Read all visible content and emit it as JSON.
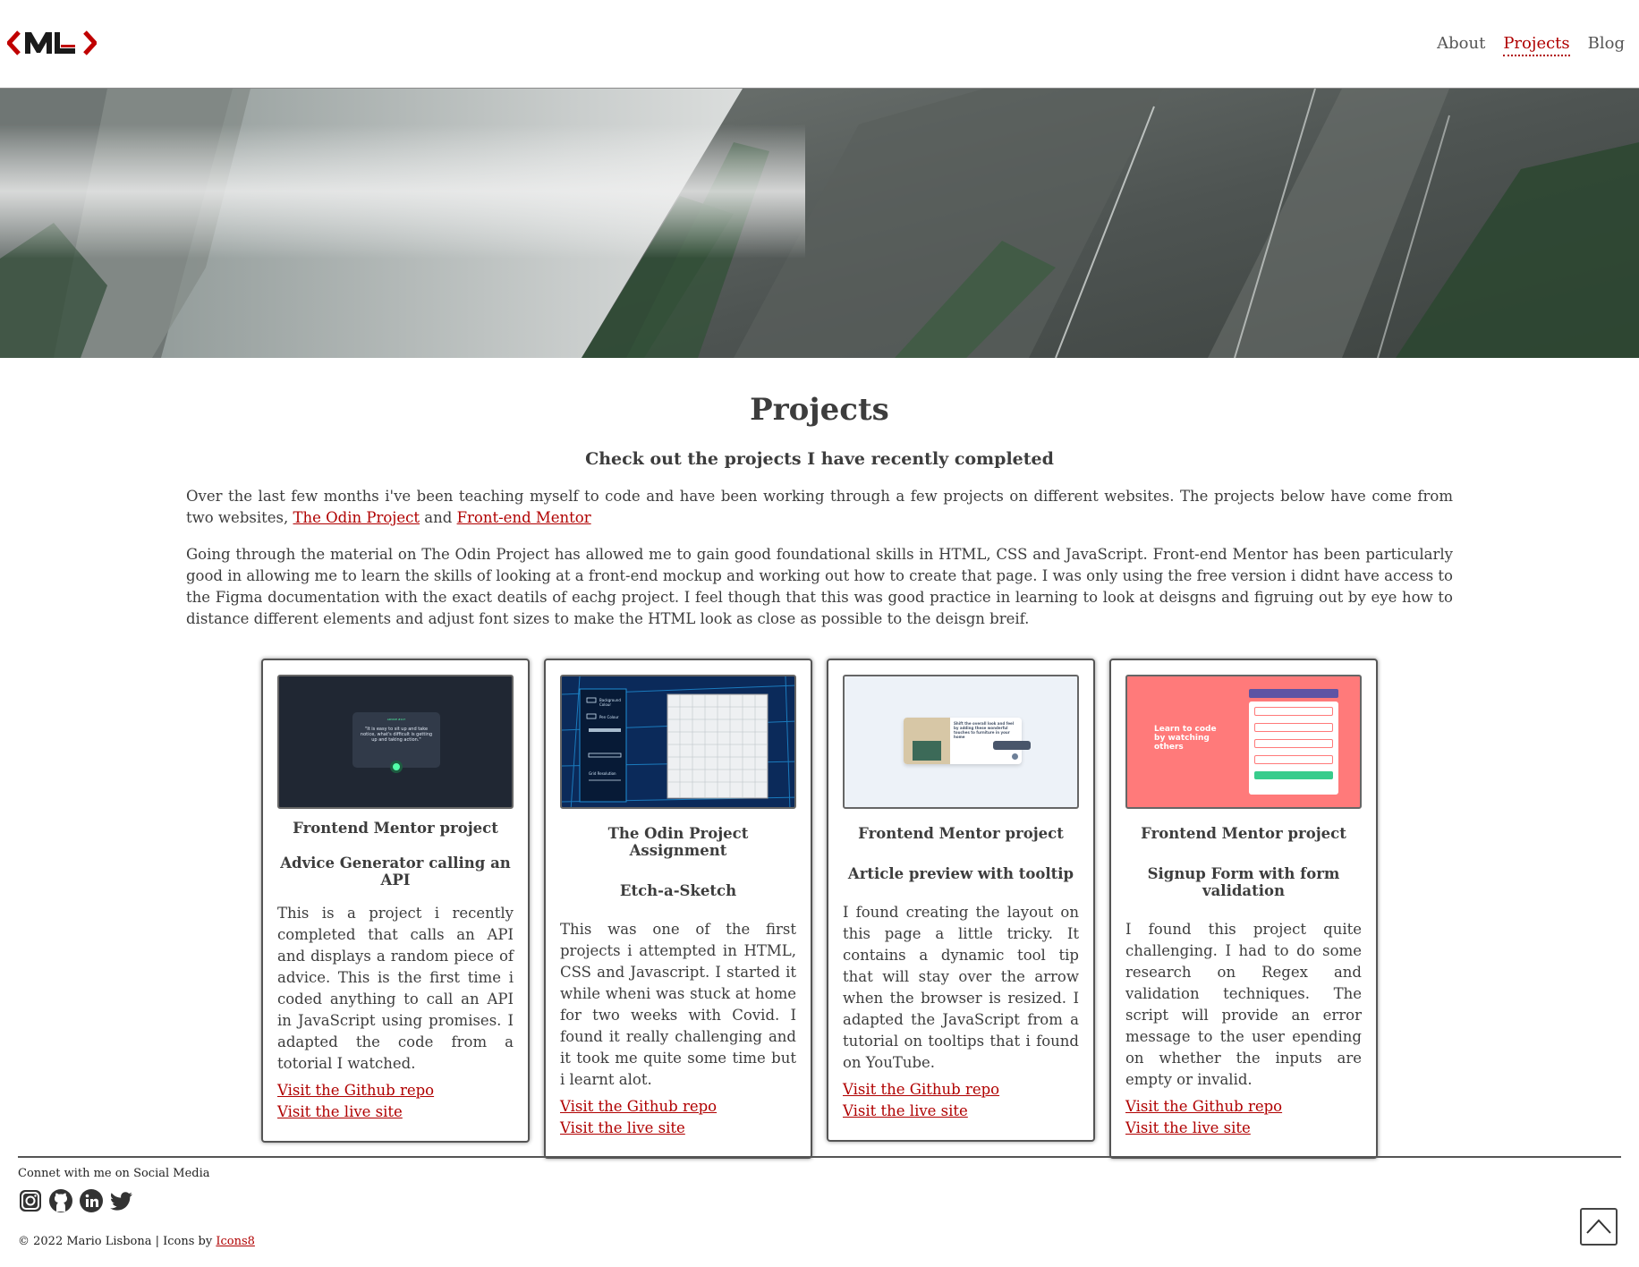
{
  "header": {
    "logo_text": "ML",
    "nav": [
      {
        "label": "About"
      },
      {
        "label": "Projects",
        "active": true
      },
      {
        "label": "Blog"
      }
    ]
  },
  "hero": {
    "icon": "mountain-landscape-photo"
  },
  "main": {
    "title": "Projects",
    "subtitle": "Check out the projects I have recently completed",
    "intro_p1_text": "Over the last few months i've been teaching myself to code and have been working through a few projects on different websites. The projects below have come from two websites, ",
    "intro_p1_link1": "The Odin Project",
    "intro_p1_and": " and ",
    "intro_p1_link2": "Front-end Mentor",
    "intro_p2": "Going through the material on The Odin Project has allowed me to gain good foundational skills in HTML, CSS and JavaScript. Front-end Mentor has been particularly good in allowing me to learn the skills of looking at a front-end mockup and working out how to create that page. I was only using the free version i didnt have access to the Figma documentation with the exact deatils of eachg project. I feel though that this was good practice in learning to look at deisgns and figruing out by eye how to distance different elements and adjust font sizes to make the HTML look as close as possible to the deisgn breif."
  },
  "projects": [
    {
      "source": "Frontend Mentor project",
      "name": "Advice Generator calling an API",
      "description": "This is a project i recently completed that calls an API and displays a random piece of advice. This is the first time i coded anything to call an API in JavaScript using promises. I adapted the code from a totorial I watched.",
      "repo_label": "Visit the Github repo",
      "live_label": "Visit the live site",
      "thumb": {
        "quote": "\"It is easy to sit up and take notice, what's difficult is getting up and taking action.\"",
        "small_label": "ADVICE #117"
      }
    },
    {
      "source": "The Odin Project Assignment",
      "name": "Etch-a-Sketch",
      "description": "This was one of the first projects i attempted in HTML, CSS and Javascript. I started it while wheni was stuck at home for two weeks with Covid. I found it really challenging and it took me quite some time but i learnt alot.",
      "repo_label": "Visit the Github repo",
      "live_label": "Visit the live site",
      "thumb": {
        "opt1": "Background Colour",
        "opt2": "Pen Colour",
        "opt3": "Grid Resolution"
      }
    },
    {
      "source": "Frontend Mentor project",
      "name": "Article preview with tooltip",
      "description": "I found creating the layout on this page a little tricky. It contains a dynamic tool tip that will stay over the arrow when the browser is resized. I adapted the JavaScript from a tutorial on tooltips that i found on YouTube.",
      "repo_label": "Visit the Github repo",
      "live_label": "Visit the live site",
      "thumb": {
        "headline": "Shift the overall look and feel by adding these wonderful touches to furniture in your home"
      }
    },
    {
      "source": "Frontend Mentor project",
      "name": "Signup Form with form validation",
      "description": "I found this project quite challenging. I had to do some research on Regex and validation techniques. The script will provide an error message to the user epending on whether the inputs are empty or invalid.",
      "repo_label": "Visit the Github repo",
      "live_label": "Visit the live site",
      "thumb": {
        "headline": "Learn to code by watching others"
      }
    }
  ],
  "footer": {
    "connect_text": "Connet with me on Social Media",
    "social_icons": [
      "instagram-icon",
      "github-icon",
      "linkedin-icon",
      "twitter-icon"
    ],
    "copyright_text": "© 2022 Mario Lisbona | Icons by ",
    "icons_link": "Icons8"
  },
  "colors": {
    "accent": "#b00000",
    "text": "#3d3d3d",
    "border": "#555555"
  }
}
